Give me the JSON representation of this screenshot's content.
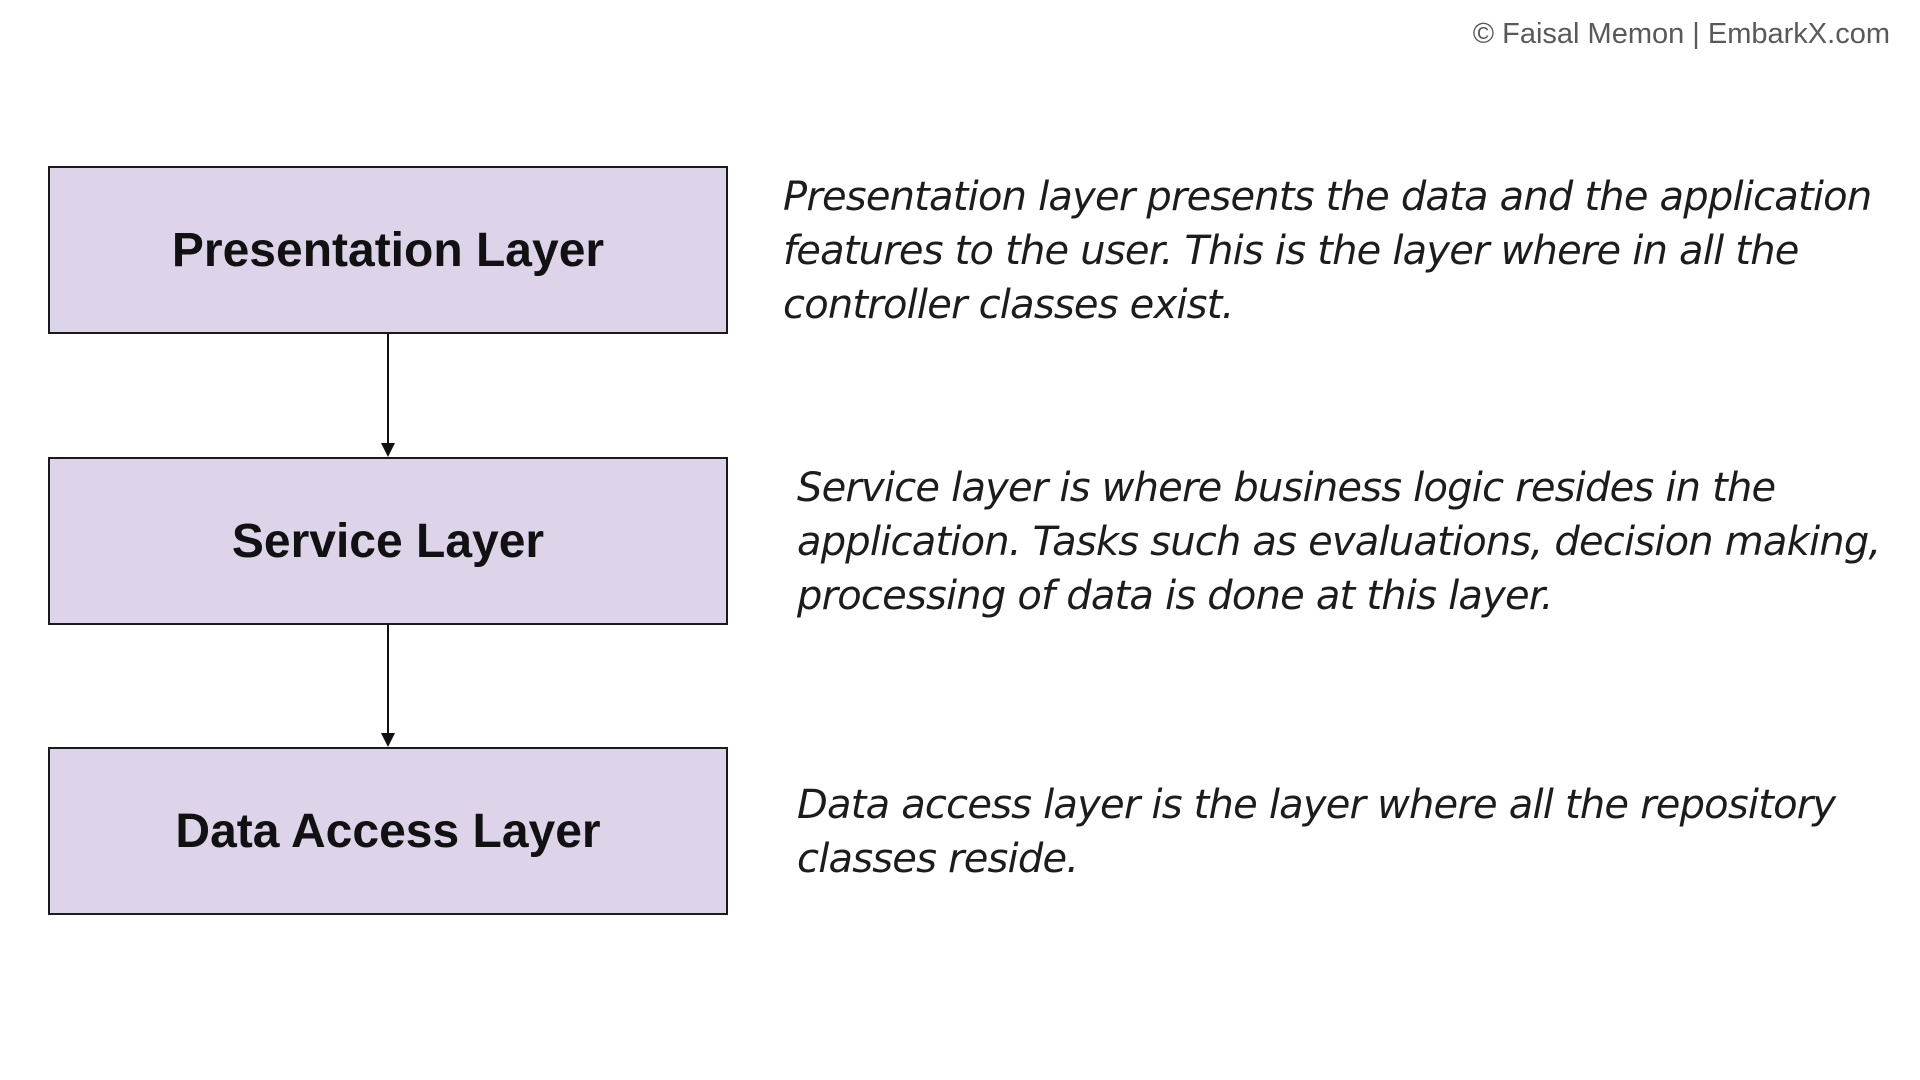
{
  "copyright": "© Faisal Memon | EmbarkX.com",
  "layers": [
    {
      "label": "Presentation Layer",
      "description": "Presentation layer presents the data and the application features to the user. This is the layer where in all the controller classes exist."
    },
    {
      "label": "Service Layer",
      "description": "Service layer is where business logic resides in the application. Tasks such as evaluations, decision making, processing of data is done at this layer."
    },
    {
      "label": "Data Access Layer",
      "description": "Data access layer is the layer where all the repository classes reside."
    }
  ],
  "colors": {
    "box_fill": "#ded4ea",
    "box_border": "#1a1a1a",
    "text": "#111111",
    "copyright": "#595959"
  }
}
